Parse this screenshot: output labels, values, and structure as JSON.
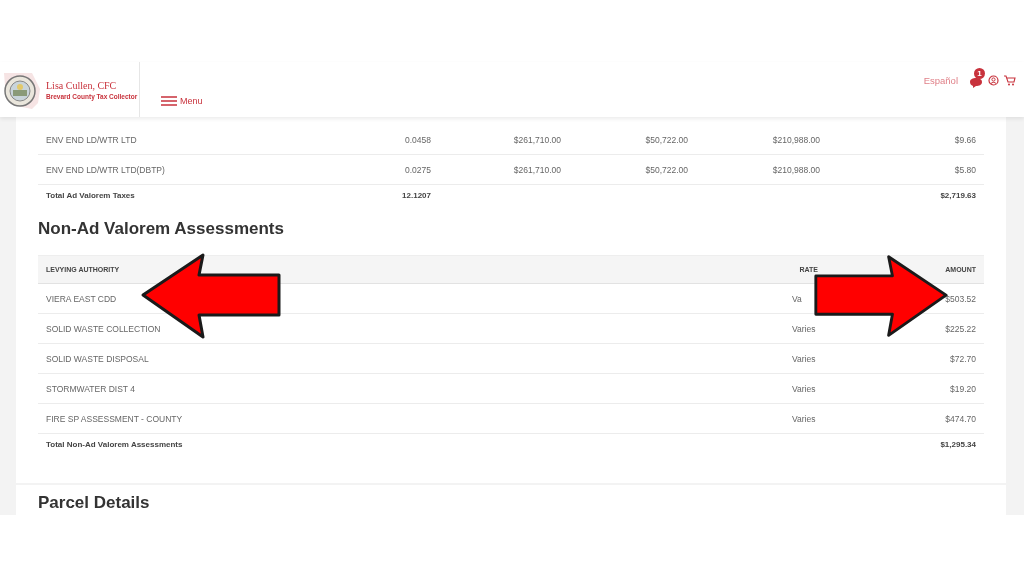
{
  "header": {
    "name": "Lisa Cullen, CFC",
    "subtitle": "Brevard County Tax Collector",
    "menu": "Menu",
    "language": "Español",
    "notification_count": "1"
  },
  "ad_valorem": {
    "rows": [
      {
        "cells": [
          "ENV END LD/WTR LTD",
          "0.0458",
          "$261,710.00",
          "$50,722.00",
          "$210,988.00",
          "$9.66"
        ]
      },
      {
        "cells": [
          "ENV END LD/WTR LTD(DBTP)",
          "0.0275",
          "$261,710.00",
          "$50,722.00",
          "$210,988.00",
          "$5.80"
        ]
      }
    ],
    "total": {
      "label": "Total Ad Valorem Taxes",
      "rate": "12.1207",
      "amount": "$2,719.63"
    }
  },
  "non_ad_valorem": {
    "title": "Non-Ad Valorem Assessments",
    "columns": [
      "LEVYING AUTHORITY",
      "RATE",
      "AMOUNT"
    ],
    "rows": [
      {
        "authority": "VIERA EAST CDD",
        "rate": "Va",
        "amount": "$503.52"
      },
      {
        "authority": "SOLID WASTE COLLECTION",
        "rate": "Varies",
        "amount": "$225.22"
      },
      {
        "authority": "SOLID WASTE DISPOSAL",
        "rate": "Varies",
        "amount": "$72.70"
      },
      {
        "authority": "STORMWATER DIST 4",
        "rate": "Varies",
        "amount": "$19.20"
      },
      {
        "authority": "FIRE SP ASSESSMENT - COUNTY",
        "rate": "Varies",
        "amount": "$474.70"
      }
    ],
    "total": {
      "label": "Total Non-Ad Valorem Assessments",
      "amount": "$1,295.34"
    }
  },
  "parcel_details": {
    "title": "Parcel Details"
  }
}
